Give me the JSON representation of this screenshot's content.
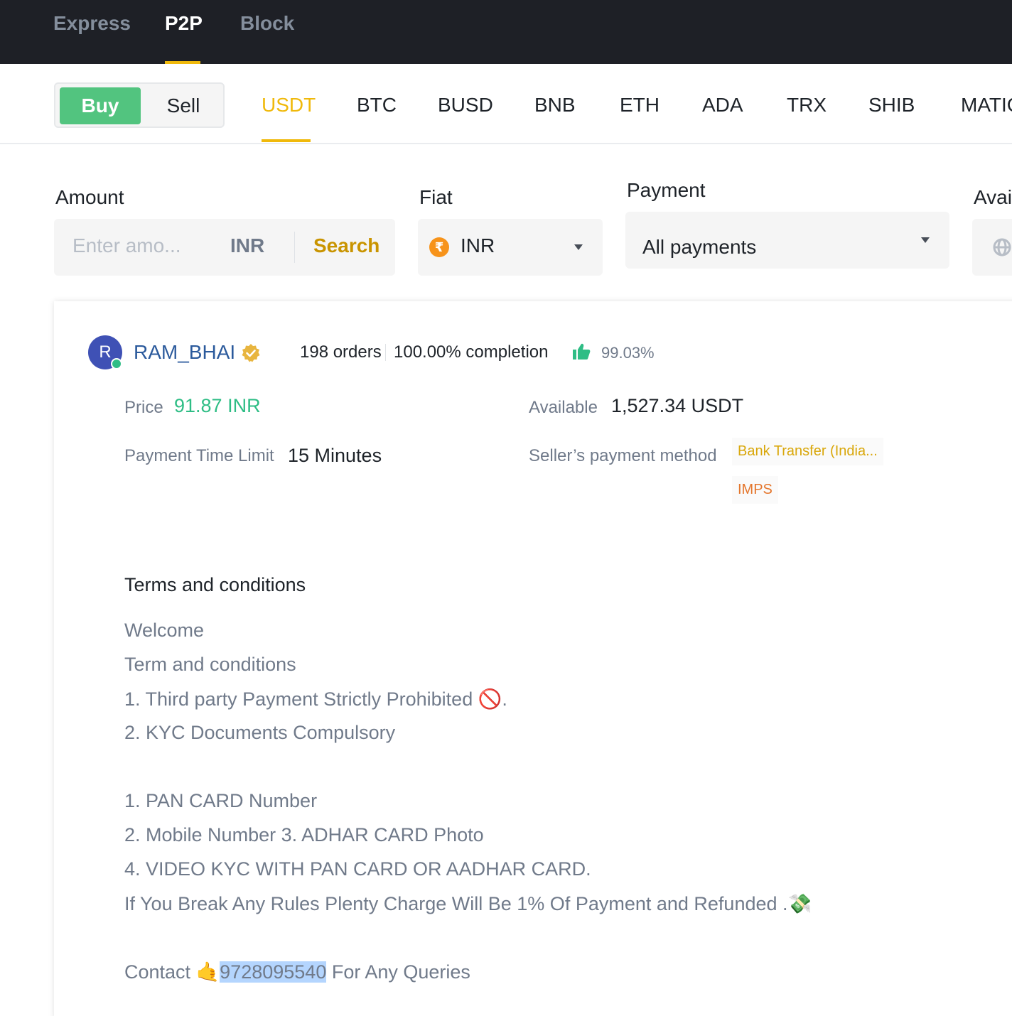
{
  "topnav": {
    "tabs": [
      {
        "label": "Express"
      },
      {
        "label": "P2P"
      },
      {
        "label": "Block"
      }
    ],
    "active_tab": "P2P"
  },
  "subhead": {
    "buy_label": "Buy",
    "sell_label": "Sell",
    "coins": [
      "USDT",
      "BTC",
      "BUSD",
      "BNB",
      "ETH",
      "ADA",
      "TRX",
      "SHIB",
      "MATIC"
    ],
    "active_coin": "USDT"
  },
  "filters": {
    "amount_label": "Amount",
    "amount_placeholder": "Enter amo...",
    "amount_currency": "INR",
    "search_label": "Search",
    "fiat_label": "Fiat",
    "fiat_symbol": "₹",
    "fiat_value": "INR",
    "payment_label": "Payment",
    "payment_value": "All payments",
    "available_label": "Avai"
  },
  "listing": {
    "avatar_letter": "R",
    "username": "RAM_BHAI",
    "orders": "198 orders",
    "completion": "100.00% completion",
    "rating": "99.03%",
    "price_label": "Price",
    "price_value": "91.87 INR",
    "available_label": "Available",
    "available_value": "1,527.34 USDT",
    "time_limit_label": "Payment Time Limit",
    "time_limit_value": "15 Minutes",
    "payment_method_label": "Seller’s payment method",
    "payment_methods": [
      "Bank Transfer (India...",
      "IMPS"
    ],
    "terms_title": "Terms and conditions",
    "terms_lines": [
      "Welcome",
      "Term and conditions",
      "1. Third party Payment Strictly Prohibited 🚫.",
      "2. KYC Documents Compulsory",
      "1. PAN CARD Number",
      "2. Mobile Number 3. ADHAR CARD Photo",
      "4. VIDEO KYC WITH  PAN CARD OR AADHAR CARD.",
      "If You Break Any Rules Plenty Charge Will Be 1% Of Payment and Refunded .💸"
    ],
    "contact_prefix": "Contact 🤙",
    "contact_number": "9728095540",
    "contact_suffix": " For Any Queries"
  },
  "colors": {
    "nav_bg": "#1e2026",
    "accent": "#f0b90b",
    "buy_green": "#52c47f",
    "price_green": "#2ebd85",
    "link_blue": "#2b5a9c",
    "avatar_bg": "#3f51b5"
  }
}
